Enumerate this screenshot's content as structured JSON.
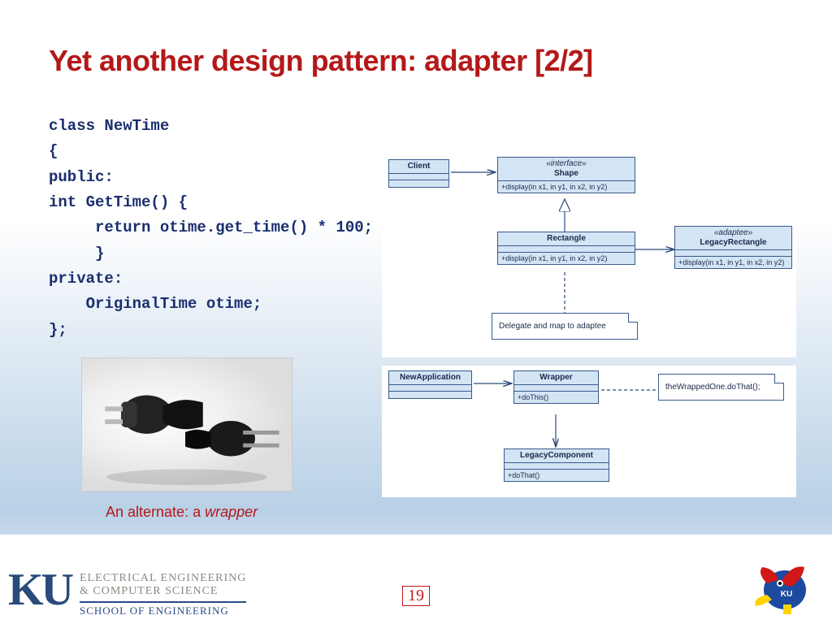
{
  "title": "Yet another design pattern: adapter [2/2]",
  "code": "class NewTime\n{\npublic:\nint GetTime() {\n     return otime.get_time() * 100;\n     }\nprivate:\n    OriginalTime otime;\n};",
  "caption_prefix": "An alternate: a ",
  "caption_em": "wrapper",
  "page_number": "19",
  "footer": {
    "ku": "KU",
    "dept1": "ELECTRICAL ENGINEERING",
    "dept2": "& COMPUTER SCIENCE",
    "school": "SCHOOL OF ENGINEERING"
  },
  "diagram1": {
    "client": "Client",
    "shape_ster": "«interface»",
    "shape": "Shape",
    "shape_op": "+display(in x1, in y1, in x2, in y2)",
    "rect": "Rectangle",
    "rect_op": "+display(in x1, in y1, in x2, in y2)",
    "adaptee_ster": "«adaptee»",
    "adaptee": "LegacyRectangle",
    "adaptee_op": "+display(in x1, in y1, in x2, in y2)",
    "note": "Delegate and map to adaptee"
  },
  "diagram2": {
    "newapp": "NewApplication",
    "wrapper": "Wrapper",
    "wrapper_op": "+doThis()",
    "legacy": "LegacyComponent",
    "legacy_op": "+doThat()",
    "note": "theWrappedOne.doThat();"
  }
}
